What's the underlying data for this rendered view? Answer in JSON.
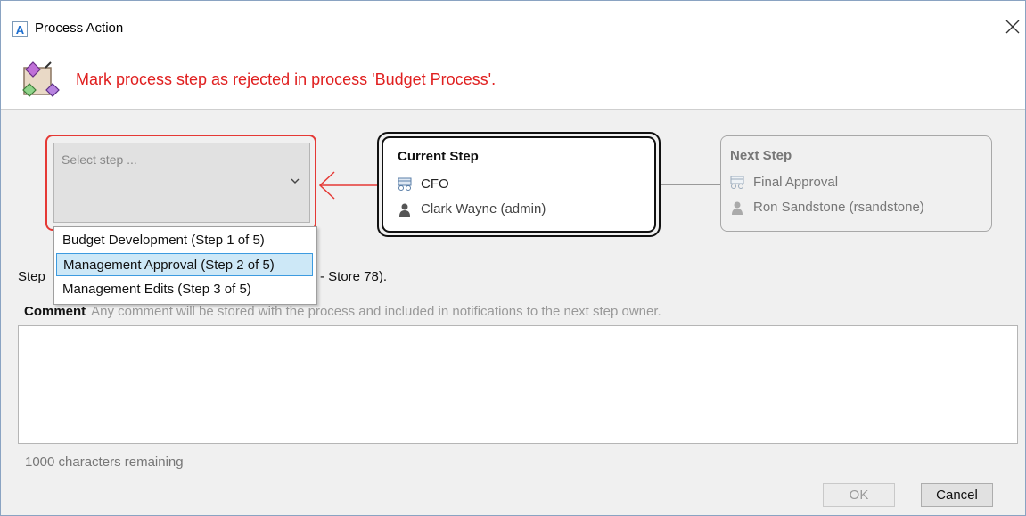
{
  "window": {
    "app_icon_letter": "A",
    "title": "Process Action"
  },
  "header": {
    "message": "Mark process step as rejected in process 'Budget Process'.",
    "message_color": "#e02020"
  },
  "select_step": {
    "placeholder": "Select step ...",
    "options": [
      "Budget Development (Step 1 of 5)",
      "Management Approval (Step 2 of 5)",
      "Management Edits (Step 3 of 5)"
    ],
    "highlighted_option": "Management Approval (Step 2 of 5)"
  },
  "current_step": {
    "heading": "Current Step",
    "step_name": "CFO",
    "owner": "Clark Wayne (admin)"
  },
  "next_step": {
    "heading": "Next Step",
    "step_name": "Final Approval",
    "owner": "Ron Sandstone (rsandstone)"
  },
  "step_info": {
    "prefix": "Step",
    "suffix": "- Store 78)."
  },
  "comment": {
    "label": "Comment",
    "hint": "Any comment will be stored with the process and included in notifications to the next step owner.",
    "value": "",
    "chars_remaining": "1000 characters remaining"
  },
  "buttons": {
    "ok": "OK",
    "cancel": "Cancel"
  },
  "colors": {
    "accent_red": "#e53935",
    "selection_bg": "#cde8f7",
    "selection_border": "#3d9be0"
  }
}
